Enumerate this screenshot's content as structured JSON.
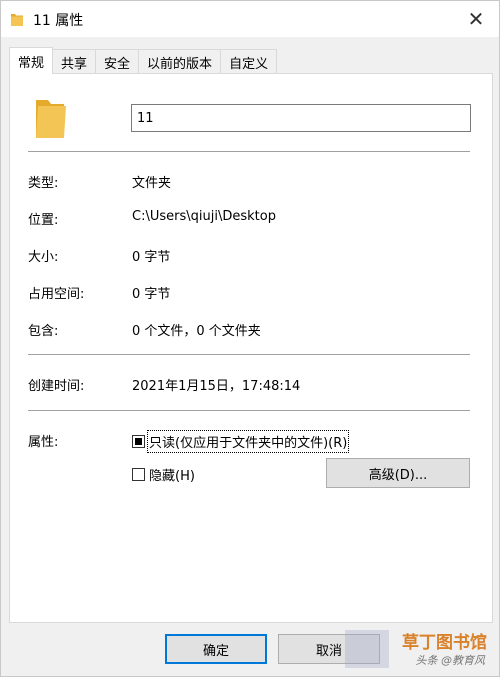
{
  "window": {
    "title": "11 属性",
    "close_label": "✕"
  },
  "tabs": [
    {
      "label": "常规",
      "active": true
    },
    {
      "label": "共享",
      "active": false
    },
    {
      "label": "安全",
      "active": false
    },
    {
      "label": "以前的版本",
      "active": false
    },
    {
      "label": "自定义",
      "active": false
    }
  ],
  "general": {
    "name_value": "11",
    "type_label": "类型:",
    "type_value": "文件夹",
    "location_label": "位置:",
    "location_value": "C:\\Users\\qiuji\\Desktop",
    "size_label": "大小:",
    "size_value": "0 字节",
    "size_on_disk_label": "占用空间:",
    "size_on_disk_value": "0 字节",
    "contains_label": "包含:",
    "contains_value": "0 个文件，0 个文件夹",
    "created_label": "创建时间:",
    "created_value": "2021年1月15日，17:48:14",
    "attributes_label": "属性:",
    "readonly_label": "只读(仅应用于文件夹中的文件)(R)",
    "readonly_state": "indeterminate",
    "hidden_label": "隐藏(H)",
    "hidden_checked": false,
    "advanced_button": "高级(D)..."
  },
  "footer": {
    "ok_label": "确定",
    "cancel_label": "取消"
  },
  "watermark": {
    "main": "草丁图书馆",
    "sub": "头条 @教育风"
  },
  "colors": {
    "accent": "#0078d7",
    "folder": "#f3c555",
    "folder_dark": "#e4aa2b"
  },
  "icons": {
    "title_icon": "folder-icon",
    "large_icon": "folder-icon"
  }
}
